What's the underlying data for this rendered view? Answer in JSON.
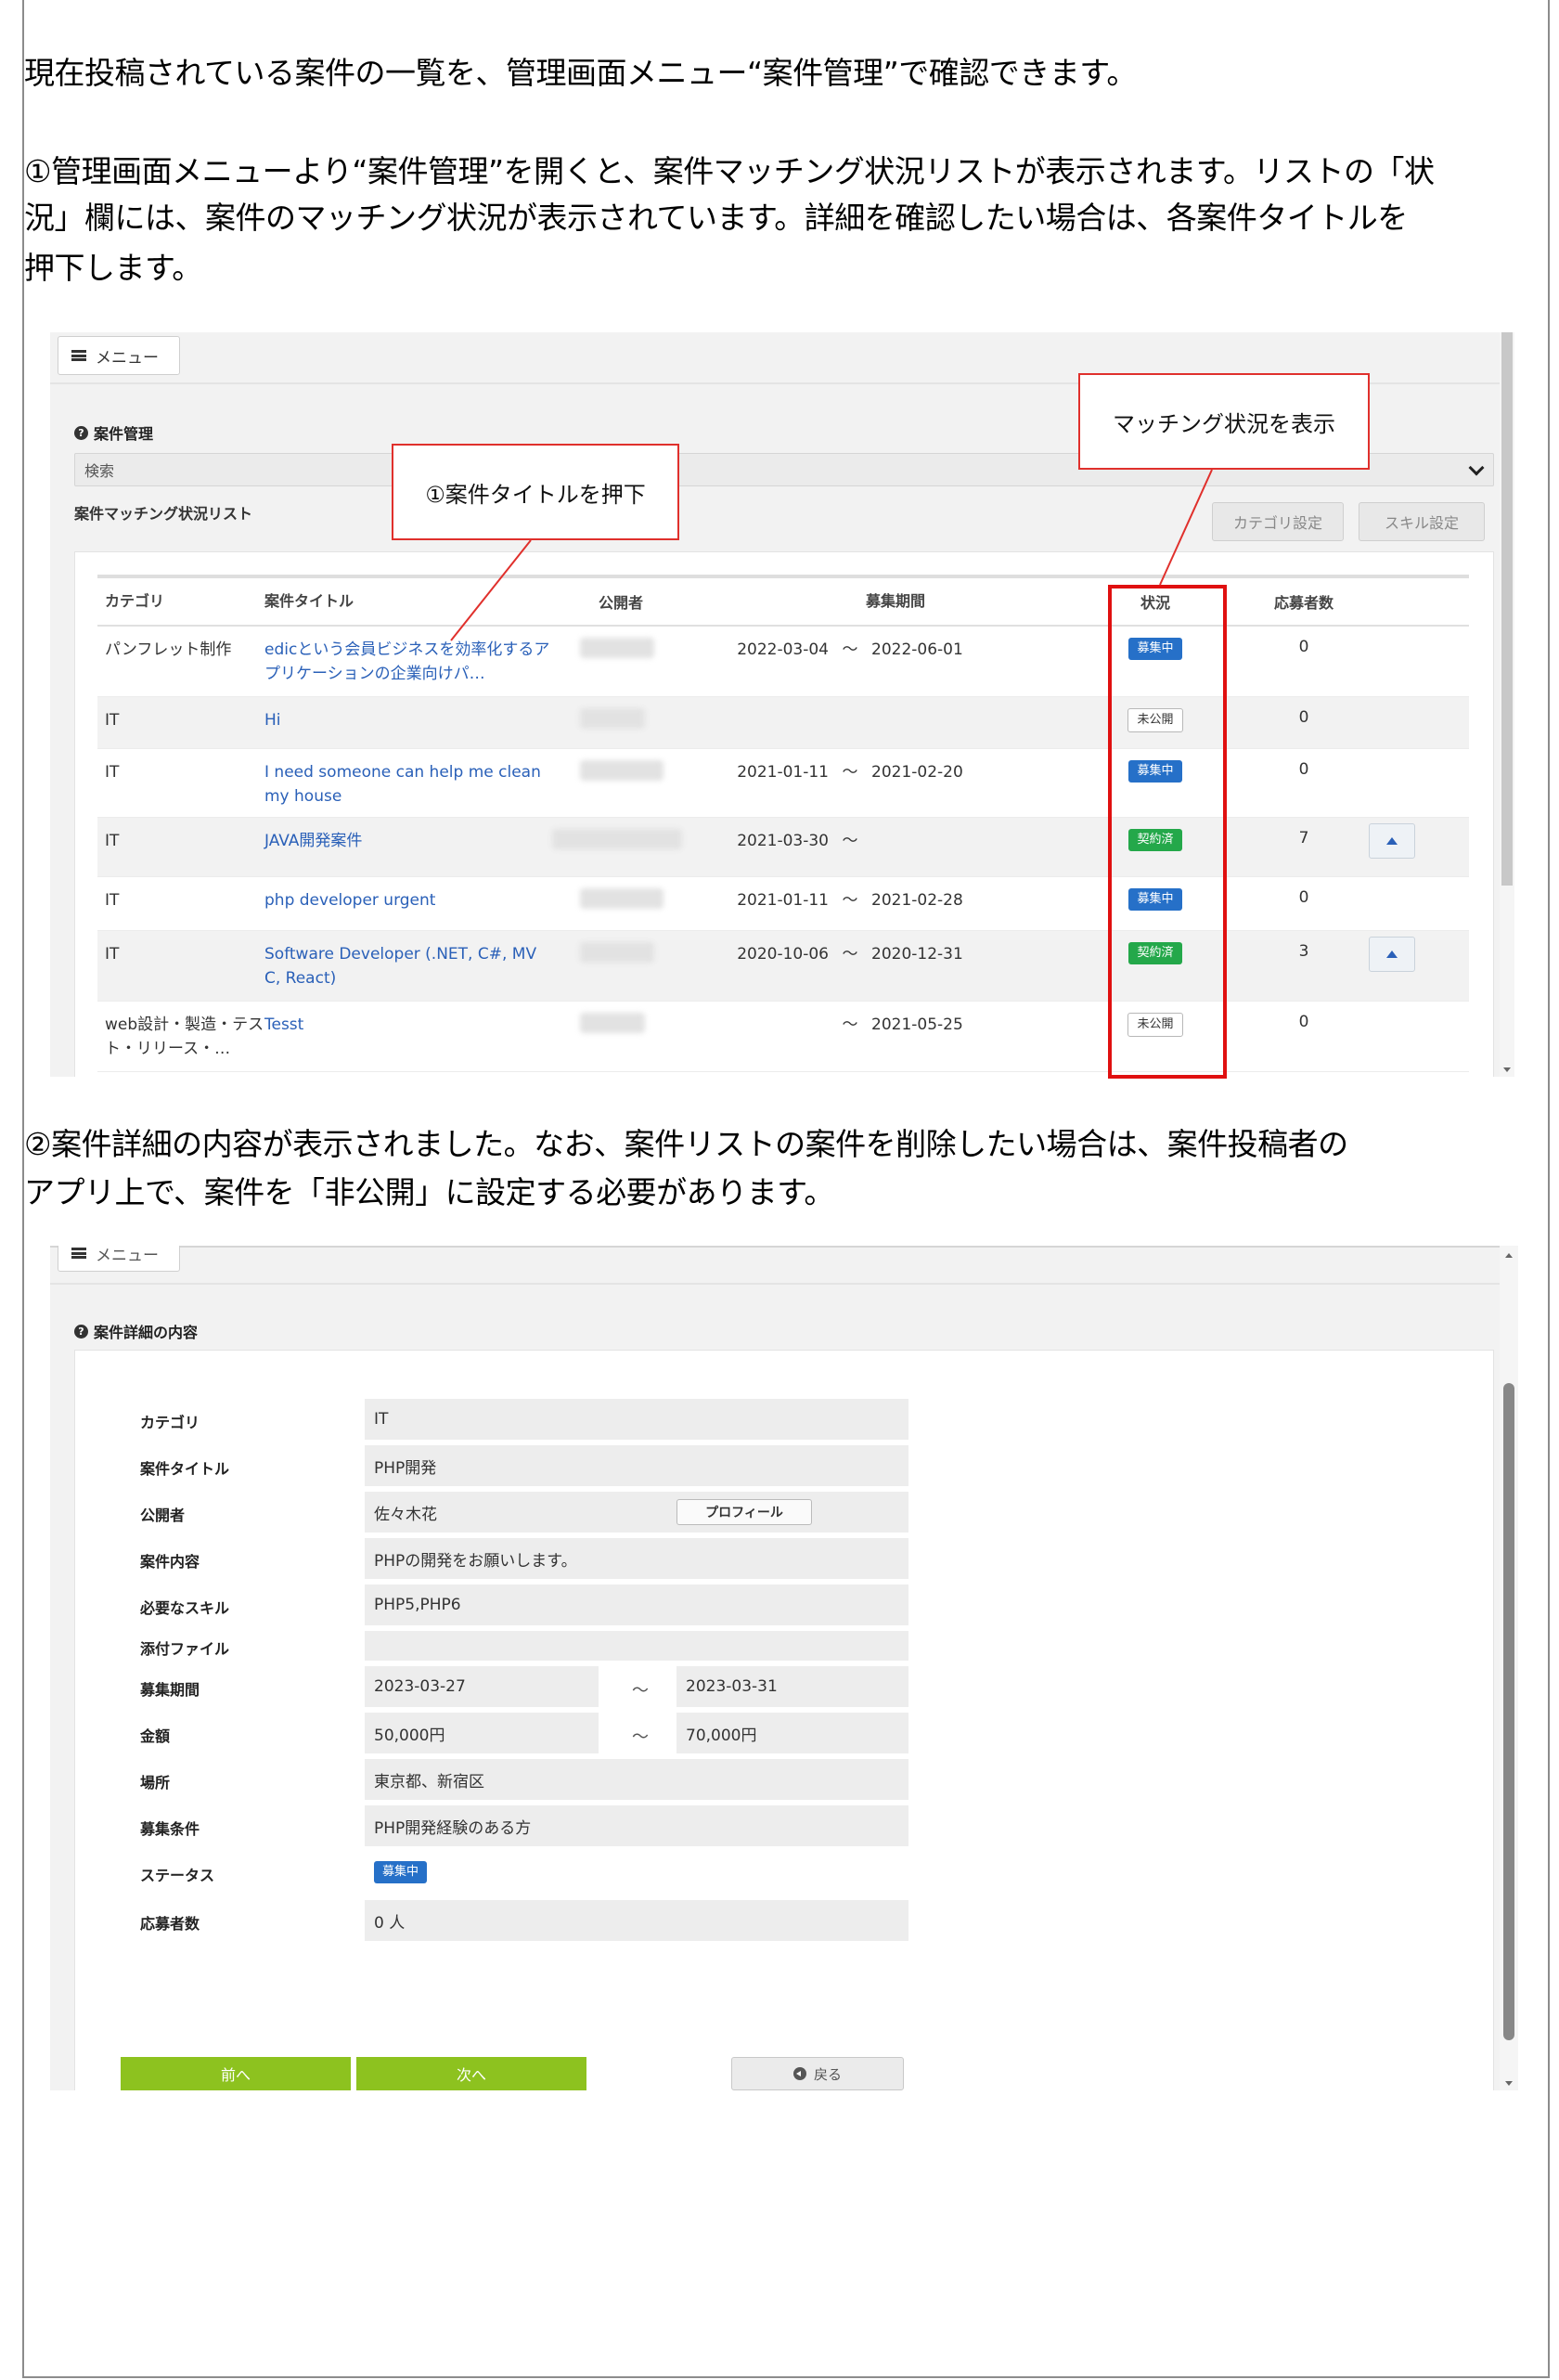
{
  "intro": "現在投稿されている案件の一覧を、管理画面メニュー“案件管理”で確認できます。",
  "step1": {
    "line1": "①管理画面メニューより“案件管理”を開くと、案件マッチング状況リストが表示されます。リストの「状",
    "line2": "況」欄には、案件のマッチング状況が表示されています。詳細を確認したい場合は、各案件タイトルを",
    "line3": "押下します。"
  },
  "step2": {
    "line1": "②案件詳細の内容が表示されました。なお、案件リストの案件を削除したい場合は、案件投稿者の",
    "line2": "アプリ上で、案件を「非公開」に設定する必要があります。"
  },
  "list_screen": {
    "menu_label": "メニュー",
    "section_title": "案件管理",
    "search_label": "検索",
    "list_title": "案件マッチング状況リスト",
    "category_settings": "カテゴリ設定",
    "skill_settings": "スキル設定",
    "columns": {
      "category": "カテゴリ",
      "title": "案件タイトル",
      "publisher": "公開者",
      "period": "募集期間",
      "status": "状況",
      "applicants": "応募者数"
    },
    "rows": [
      {
        "category": "パンフレット制作",
        "title": "edicという会員ビジネスを効率化するアプリケーションの企業向けパ…",
        "start": "2022-03-04",
        "tilde": "～",
        "end": "2022-06-01",
        "status": "募集中",
        "status_type": "blue",
        "count": "0",
        "action": false
      },
      {
        "category": "IT",
        "title": "Hi",
        "start": "",
        "tilde": "",
        "end": "",
        "status": "未公開",
        "status_type": "gray",
        "count": "0",
        "action": false
      },
      {
        "category": "IT",
        "title": "I need someone can help me clean my house",
        "start": "2021-01-11",
        "tilde": "～",
        "end": "2021-02-20",
        "status": "募集中",
        "status_type": "blue",
        "count": "0",
        "action": false
      },
      {
        "category": "IT",
        "title": "JAVA開発案件",
        "start": "2021-03-30",
        "tilde": "～",
        "end": "",
        "status": "契約済",
        "status_type": "green",
        "count": "7",
        "action": true
      },
      {
        "category": "IT",
        "title": "php developer urgent",
        "start": "2021-01-11",
        "tilde": "～",
        "end": "2021-02-28",
        "status": "募集中",
        "status_type": "blue",
        "count": "0",
        "action": false
      },
      {
        "category": "IT",
        "title": "Software Developer (.NET, C#, MVC, React)",
        "start": "2020-10-06",
        "tilde": "～",
        "end": "2020-12-31",
        "status": "契約済",
        "status_type": "green",
        "count": "3",
        "action": true
      },
      {
        "category": "web設計・製造・テスト・リリース・…",
        "title": "Tesst",
        "start": "",
        "tilde": "～",
        "end": "2021-05-25",
        "status": "未公開",
        "status_type": "gray",
        "count": "0",
        "action": false
      }
    ],
    "callout_title": "①案件タイトルを押下",
    "callout_status": "マッチング状況を表示"
  },
  "detail_screen": {
    "menu_label": "メニュー",
    "section_title": "案件詳細の内容",
    "fields": {
      "category": {
        "label": "カテゴリ",
        "value": "IT"
      },
      "title": {
        "label": "案件タイトル",
        "value": "PHP開発"
      },
      "publisher": {
        "label": "公開者",
        "value": "佐々木花"
      },
      "content": {
        "label": "案件内容",
        "value": "PHPの開発をお願いします。"
      },
      "skills": {
        "label": "必要なスキル",
        "value": "PHP5,PHP6"
      },
      "attachment": {
        "label": "添付ファイル",
        "value": ""
      },
      "period": {
        "label": "募集期間",
        "start": "2023-03-27",
        "tilde": "～",
        "end": "2023-03-31"
      },
      "amount": {
        "label": "金額",
        "min": "50,000円",
        "tilde": "～",
        "max": "70,000円"
      },
      "place": {
        "label": "場所",
        "value": "東京都、新宿区"
      },
      "conditions": {
        "label": "募集条件",
        "value": "PHP開発経験のある方"
      },
      "status": {
        "label": "ステータス",
        "value": "募集中"
      },
      "applicants": {
        "label": "応募者数",
        "value": "0 人"
      }
    },
    "profile_button": "プロフィール",
    "prev_button": "前へ",
    "next_button": "次へ",
    "back_button": "戻る"
  },
  "colors": {
    "accent_blue": "#2670c8",
    "status_green": "#24a84a",
    "button_green": "#8dc21f",
    "callout_red": "#e01010"
  }
}
